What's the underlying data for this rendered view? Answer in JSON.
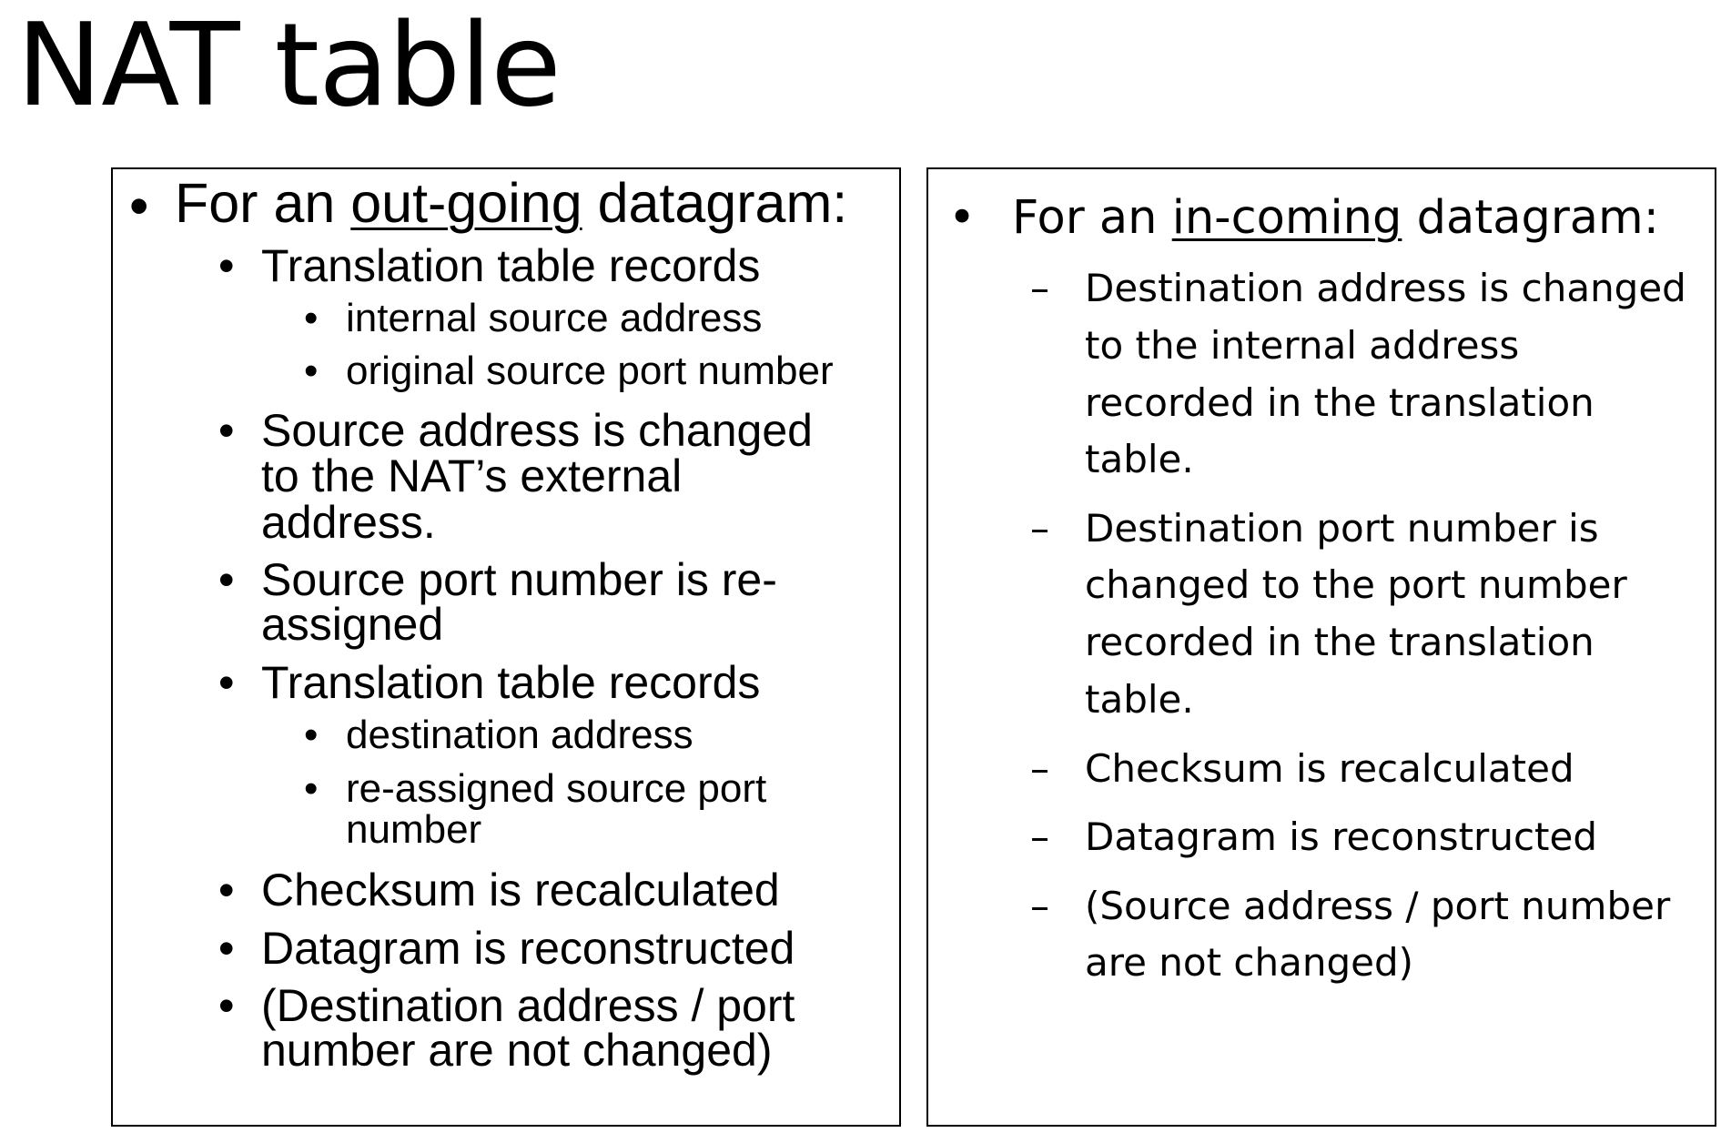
{
  "title": "NAT table",
  "outgoing": {
    "heading_prefix": "For an ",
    "heading_emphasis": "out-going",
    "heading_suffix": " datagram:",
    "items": [
      {
        "lines": [
          "Translation table records"
        ],
        "subitems": [
          {
            "lines": [
              "internal source address"
            ]
          },
          {
            "lines": [
              "original source port number"
            ]
          }
        ]
      },
      {
        "lines": [
          "Source address is changed",
          "to the NAT’s external",
          "address."
        ]
      },
      {
        "lines": [
          "Source port number is re-",
          "assigned"
        ]
      },
      {
        "lines": [
          "Translation table records"
        ],
        "subitems": [
          {
            "lines": [
              "destination address"
            ]
          },
          {
            "lines": [
              "re-assigned source port",
              "number"
            ]
          }
        ]
      },
      {
        "lines": [
          "Checksum is recalculated"
        ]
      },
      {
        "lines": [
          "Datagram is reconstructed"
        ]
      },
      {
        "lines": [
          "(Destination address / port",
          "number are not changed)"
        ]
      }
    ]
  },
  "incoming": {
    "heading_prefix": "For an ",
    "heading_emphasis": "in-coming",
    "heading_suffix": " datagram:",
    "items": [
      {
        "lines": [
          "Destination address is changed",
          "to the internal address",
          "recorded in the translation",
          "table."
        ]
      },
      {
        "lines": [
          "Destination port number is",
          "changed to the port number",
          "recorded in the translation",
          "table."
        ]
      },
      {
        "lines": [
          "Checksum is recalculated"
        ]
      },
      {
        "lines": [
          "Datagram is reconstructed"
        ]
      },
      {
        "lines": [
          "(Source address / port number",
          "are not changed)"
        ]
      }
    ]
  }
}
